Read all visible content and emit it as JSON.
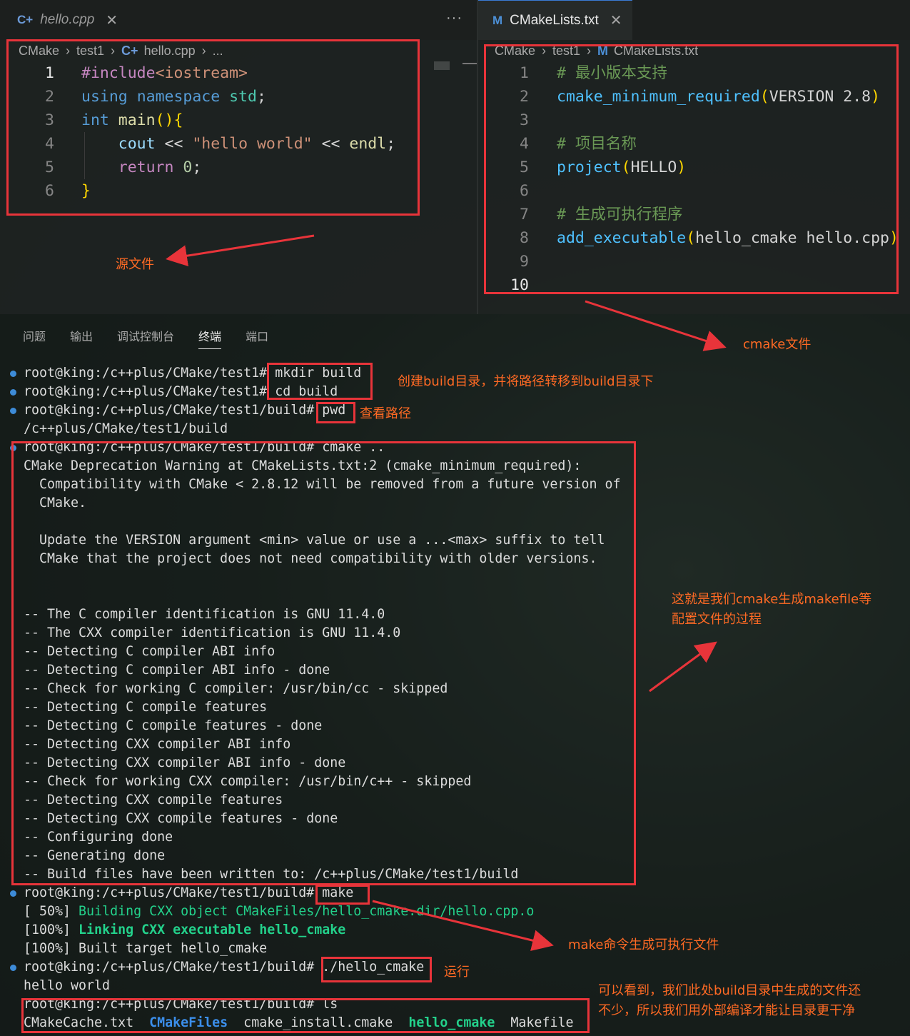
{
  "left_editor": {
    "tab_label": "hello.cpp",
    "breadcrumb": [
      "CMake",
      "test1",
      "hello.cpp",
      "..."
    ],
    "lines": [
      {
        "n": "1",
        "tokens": [
          {
            "t": "#include",
            "c": "pp"
          },
          {
            "t": "<iostream>",
            "c": "st"
          }
        ]
      },
      {
        "n": "2",
        "tokens": [
          {
            "t": "using",
            "c": "kw"
          },
          {
            "t": " ",
            "c": "pl"
          },
          {
            "t": "namespace",
            "c": "kw"
          },
          {
            "t": " ",
            "c": "pl"
          },
          {
            "t": "std",
            "c": "ty"
          },
          {
            "t": ";",
            "c": "pl"
          }
        ]
      },
      {
        "n": "3",
        "tokens": [
          {
            "t": "int",
            "c": "kw"
          },
          {
            "t": " ",
            "c": "pl"
          },
          {
            "t": "main",
            "c": "fn"
          },
          {
            "t": "(){",
            "c": "br"
          }
        ]
      },
      {
        "n": "4",
        "tokens": [
          {
            "t": "    ",
            "c": "pl"
          },
          {
            "t": "cout",
            "c": "id"
          },
          {
            "t": " << ",
            "c": "pl"
          },
          {
            "t": "\"hello world\"",
            "c": "st"
          },
          {
            "t": " << ",
            "c": "pl"
          },
          {
            "t": "endl",
            "c": "fn"
          },
          {
            "t": ";",
            "c": "pl"
          }
        ]
      },
      {
        "n": "5",
        "tokens": [
          {
            "t": "    ",
            "c": "pl"
          },
          {
            "t": "return",
            "c": "pp"
          },
          {
            "t": " ",
            "c": "pl"
          },
          {
            "t": "0",
            "c": "nm"
          },
          {
            "t": ";",
            "c": "pl"
          }
        ]
      },
      {
        "n": "6",
        "tokens": [
          {
            "t": "}",
            "c": "br"
          }
        ]
      }
    ]
  },
  "right_editor": {
    "tab_label": "CMakeLists.txt",
    "breadcrumb": [
      "CMake",
      "test1",
      "CMakeLists.txt"
    ],
    "lines": [
      {
        "n": "1",
        "tokens": [
          {
            "t": "# 最小版本支持",
            "c": "cm"
          }
        ]
      },
      {
        "n": "2",
        "tokens": [
          {
            "t": "cmake_minimum_required",
            "c": "ck"
          },
          {
            "t": "(",
            "c": "br"
          },
          {
            "t": "VERSION 2.8",
            "c": "pl"
          },
          {
            "t": ")",
            "c": "br"
          }
        ]
      },
      {
        "n": "3",
        "tokens": []
      },
      {
        "n": "4",
        "tokens": [
          {
            "t": "# 项目名称",
            "c": "cm"
          }
        ]
      },
      {
        "n": "5",
        "tokens": [
          {
            "t": "project",
            "c": "ck"
          },
          {
            "t": "(",
            "c": "br"
          },
          {
            "t": "HELLO",
            "c": "pl"
          },
          {
            "t": ")",
            "c": "br"
          }
        ]
      },
      {
        "n": "6",
        "tokens": []
      },
      {
        "n": "7",
        "tokens": [
          {
            "t": "# 生成可执行程序",
            "c": "cm"
          }
        ]
      },
      {
        "n": "8",
        "tokens": [
          {
            "t": "add_executable",
            "c": "ck"
          },
          {
            "t": "(",
            "c": "br"
          },
          {
            "t": "hello_cmake hello.cpp",
            "c": "pl"
          },
          {
            "t": ")",
            "c": "br"
          }
        ]
      },
      {
        "n": "9",
        "tokens": []
      },
      {
        "n": "10",
        "tokens": []
      }
    ]
  },
  "panel_tabs": [
    "问题",
    "输出",
    "调试控制台",
    "终端",
    "端口"
  ],
  "panel_active_tab": "终端",
  "terminal": [
    {
      "dot": true,
      "spans": [
        {
          "t": "root@king:/c++plus/CMake/test1# mkdir build"
        }
      ]
    },
    {
      "dot": true,
      "spans": [
        {
          "t": "root@king:/c++plus/CMake/test1# cd build"
        }
      ]
    },
    {
      "dot": true,
      "spans": [
        {
          "t": "root@king:/c++plus/CMake/test1/build# pwd"
        }
      ]
    },
    {
      "dot": false,
      "spans": [
        {
          "t": "/c++plus/CMake/test1/build"
        }
      ]
    },
    {
      "dot": true,
      "spans": [
        {
          "t": "root@king:/c++plus/CMake/test1/build# cmake .."
        }
      ]
    },
    {
      "dot": false,
      "spans": [
        {
          "t": "CMake Deprecation Warning at CMakeLists.txt:2 (cmake_minimum_required):"
        }
      ]
    },
    {
      "dot": false,
      "spans": [
        {
          "t": "  Compatibility with CMake < 2.8.12 will be removed from a future version of"
        }
      ]
    },
    {
      "dot": false,
      "spans": [
        {
          "t": "  CMake."
        }
      ]
    },
    {
      "dot": false,
      "spans": [
        {
          "t": ""
        }
      ]
    },
    {
      "dot": false,
      "spans": [
        {
          "t": "  Update the VERSION argument <min> value or use a ...<max> suffix to tell"
        }
      ]
    },
    {
      "dot": false,
      "spans": [
        {
          "t": "  CMake that the project does not need compatibility with older versions."
        }
      ]
    },
    {
      "dot": false,
      "spans": [
        {
          "t": ""
        }
      ]
    },
    {
      "dot": false,
      "spans": [
        {
          "t": ""
        }
      ]
    },
    {
      "dot": false,
      "spans": [
        {
          "t": "-- The C compiler identification is GNU 11.4.0"
        }
      ]
    },
    {
      "dot": false,
      "spans": [
        {
          "t": "-- The CXX compiler identification is GNU 11.4.0"
        }
      ]
    },
    {
      "dot": false,
      "spans": [
        {
          "t": "-- Detecting C compiler ABI info"
        }
      ]
    },
    {
      "dot": false,
      "spans": [
        {
          "t": "-- Detecting C compiler ABI info - done"
        }
      ]
    },
    {
      "dot": false,
      "spans": [
        {
          "t": "-- Check for working C compiler: /usr/bin/cc - skipped"
        }
      ]
    },
    {
      "dot": false,
      "spans": [
        {
          "t": "-- Detecting C compile features"
        }
      ]
    },
    {
      "dot": false,
      "spans": [
        {
          "t": "-- Detecting C compile features - done"
        }
      ]
    },
    {
      "dot": false,
      "spans": [
        {
          "t": "-- Detecting CXX compiler ABI info"
        }
      ]
    },
    {
      "dot": false,
      "spans": [
        {
          "t": "-- Detecting CXX compiler ABI info - done"
        }
      ]
    },
    {
      "dot": false,
      "spans": [
        {
          "t": "-- Check for working CXX compiler: /usr/bin/c++ - skipped"
        }
      ]
    },
    {
      "dot": false,
      "spans": [
        {
          "t": "-- Detecting CXX compile features"
        }
      ]
    },
    {
      "dot": false,
      "spans": [
        {
          "t": "-- Detecting CXX compile features - done"
        }
      ]
    },
    {
      "dot": false,
      "spans": [
        {
          "t": "-- Configuring done"
        }
      ]
    },
    {
      "dot": false,
      "spans": [
        {
          "t": "-- Generating done"
        }
      ]
    },
    {
      "dot": false,
      "spans": [
        {
          "t": "-- Build files have been written to: /c++plus/CMake/test1/build"
        }
      ]
    },
    {
      "dot": true,
      "spans": [
        {
          "t": "root@king:/c++plus/CMake/test1/build# make"
        }
      ]
    },
    {
      "dot": false,
      "spans": [
        {
          "t": "[ 50%] "
        },
        {
          "t": "Building CXX object CMakeFiles/hello_cmake.dir/hello.cpp.o",
          "c": "g"
        }
      ]
    },
    {
      "dot": false,
      "spans": [
        {
          "t": "[100%] "
        },
        {
          "t": "Linking CXX executable hello_cmake",
          "c": "gb"
        }
      ]
    },
    {
      "dot": false,
      "spans": [
        {
          "t": "[100%] Built target hello_cmake"
        }
      ]
    },
    {
      "dot": true,
      "spans": [
        {
          "t": "root@king:/c++plus/CMake/test1/build# ./hello_cmake"
        }
      ]
    },
    {
      "dot": false,
      "spans": [
        {
          "t": "hello world"
        }
      ]
    },
    {
      "dot": false,
      "spans": [
        {
          "t": "root@king:/c++plus/CMake/test1/build# ls"
        }
      ]
    },
    {
      "dot": false,
      "spans": [
        {
          "t": "CMakeCache.txt  "
        },
        {
          "t": "CMakeFiles",
          "c": "bb"
        },
        {
          "t": "  cmake_install.cmake  "
        },
        {
          "t": "hello_cmake",
          "c": "gb"
        },
        {
          "t": "  Makefile"
        }
      ]
    }
  ],
  "annotations": {
    "source_file": "源文件",
    "cmake_file": "cmake文件",
    "mkdir_cd": "创建build目录，并将路径转移到build目录下",
    "pwd": "查看路径",
    "cmake_process": "这就是我们cmake生成makefile等\n配置文件的过程",
    "make": "make命令生成可执行文件",
    "run": "运行",
    "ls": "可以看到，我们此处build目录中生成的文件还\n不少，所以我们用外部编译才能让目录更干净"
  },
  "colors": {
    "annotation_red": "#e8343a",
    "annotation_orange": "#ff6a24",
    "terminal_green": "#23d18b",
    "terminal_blue": "#3b8eea"
  }
}
